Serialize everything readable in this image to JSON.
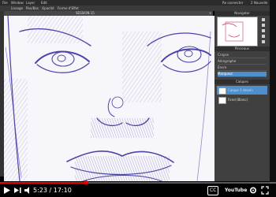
{
  "app": {
    "menu": [
      "File",
      "Window",
      "Layer",
      "Edit"
    ],
    "menu_right": [
      "Re connecter",
      "2 Nouvelle"
    ],
    "toolbar": [
      "Lissage",
      "Pan/Bas",
      "Opacité",
      "Forme d'Effet"
    ],
    "canvas_title": "SESSION 15",
    "canvas_close": "×"
  },
  "panels": {
    "navigator": {
      "title": "Navigator"
    },
    "brushes": {
      "title": "Pinceaux",
      "items": [
        "Crayon",
        "Aérographe",
        "Encre",
        "Marqueur"
      ],
      "selected_index": 3
    },
    "layers": {
      "title": "Calques",
      "items": [
        {
          "name": "Calque 1 dessin"
        },
        {
          "name": "Fond (Blanc)"
        }
      ],
      "selected_index": 0
    }
  },
  "player": {
    "time": "5:23 / 17:10",
    "progress": 0.31,
    "cc": "CC",
    "logo": "YouTube"
  }
}
